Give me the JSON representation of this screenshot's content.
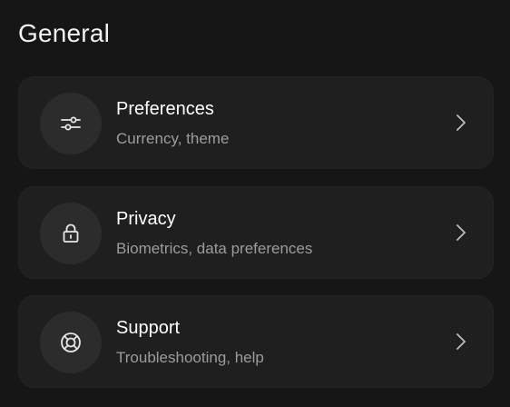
{
  "section": {
    "title": "General"
  },
  "items": [
    {
      "title": "Preferences",
      "subtitle": "Currency, theme",
      "icon": "sliders-icon"
    },
    {
      "title": "Privacy",
      "subtitle": "Biometrics, data preferences",
      "icon": "lock-icon"
    },
    {
      "title": "Support",
      "subtitle": "Troubleshooting, help",
      "icon": "lifebuoy-icon"
    }
  ],
  "colors": {
    "background": "#161616",
    "card": "#1f1f1f",
    "icon_circle": "#2c2c2c",
    "title_text": "#ffffff",
    "subtitle_text": "#9c9c9c"
  }
}
